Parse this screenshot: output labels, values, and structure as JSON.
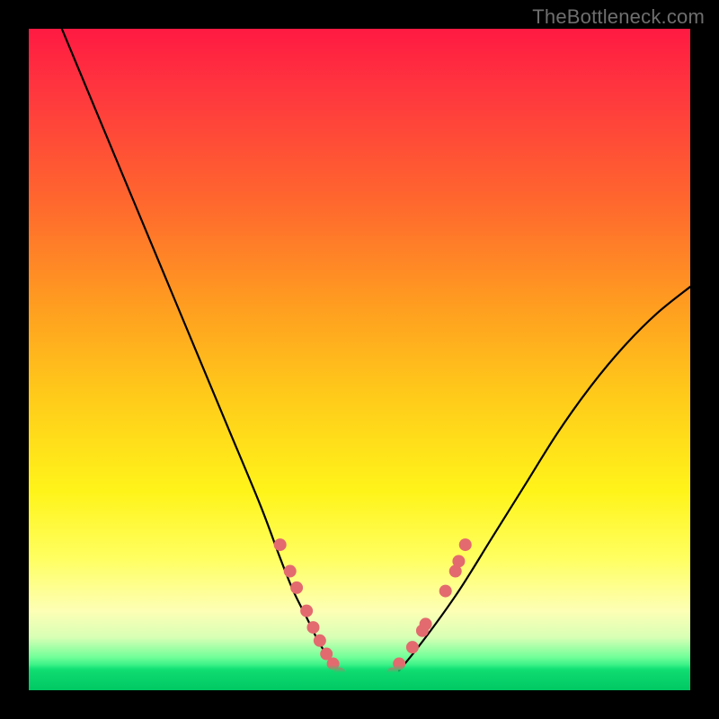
{
  "watermark": "TheBottleneck.com",
  "colors": {
    "frame": "#000000",
    "curve_stroke": "#000000",
    "marker_fill": "#e36a6e",
    "flat_segment": "#e06a6e"
  },
  "chart_data": {
    "type": "line",
    "title": "",
    "xlabel": "",
    "ylabel": "",
    "xlim": [
      0,
      100
    ],
    "ylim": [
      0,
      100
    ],
    "grid": false,
    "legend": false,
    "series": [
      {
        "name": "bottleneck-curve",
        "x": [
          5,
          10,
          15,
          20,
          25,
          30,
          35,
          38,
          40,
          42,
          44,
          46,
          48,
          49,
          51,
          54,
          56,
          60,
          65,
          70,
          75,
          80,
          85,
          90,
          95,
          100
        ],
        "y": [
          100,
          88,
          76,
          64,
          52,
          40,
          28,
          20,
          15,
          11,
          7,
          4,
          1,
          0,
          0,
          1,
          3,
          8,
          15,
          23,
          31,
          39,
          46,
          52,
          57,
          61
        ]
      }
    ],
    "markers": {
      "name": "highlight-points",
      "points": [
        {
          "x": 38,
          "y": 22
        },
        {
          "x": 39.5,
          "y": 18
        },
        {
          "x": 40.5,
          "y": 15.5
        },
        {
          "x": 42,
          "y": 12
        },
        {
          "x": 43,
          "y": 9.5
        },
        {
          "x": 44,
          "y": 7.5
        },
        {
          "x": 45,
          "y": 5.5
        },
        {
          "x": 46,
          "y": 4
        },
        {
          "x": 47,
          "y": 2.5
        },
        {
          "x": 55,
          "y": 2.5
        },
        {
          "x": 56,
          "y": 4
        },
        {
          "x": 58,
          "y": 6.5
        },
        {
          "x": 59.5,
          "y": 9
        },
        {
          "x": 60,
          "y": 10
        },
        {
          "x": 63,
          "y": 15
        },
        {
          "x": 64.5,
          "y": 18
        },
        {
          "x": 65,
          "y": 19.5
        },
        {
          "x": 66,
          "y": 22
        }
      ]
    },
    "flat_segment": {
      "x_start": 47,
      "x_end": 55,
      "y": 0.7
    }
  }
}
